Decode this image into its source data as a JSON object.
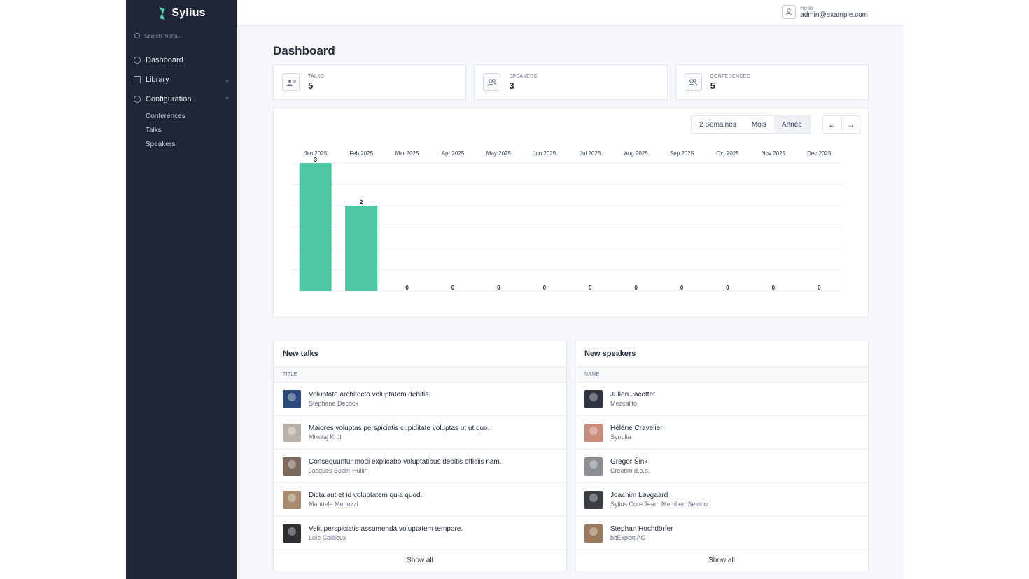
{
  "brand": {
    "name": "Sylius",
    "accent": "#4fc7a4"
  },
  "sidebar": {
    "search_placeholder": "Search menu...",
    "items": [
      {
        "label": "Dashboard",
        "icon": "dashboard-icon"
      },
      {
        "label": "Library",
        "icon": "book-icon",
        "chevron": "⌄"
      },
      {
        "label": "Configuration",
        "icon": "gear-icon",
        "chevron": "⌃"
      }
    ],
    "sub_items": [
      "Conferences",
      "Talks",
      "Speakers"
    ]
  },
  "topbar": {
    "hello": "Hello",
    "email": "admin@example.com"
  },
  "page": {
    "title": "Dashboard"
  },
  "stats": [
    {
      "label": "TALKS",
      "value": "5",
      "icon": "talk-icon"
    },
    {
      "label": "SPEAKERS",
      "value": "3",
      "icon": "users-icon"
    },
    {
      "label": "CONFERENCES",
      "value": "5",
      "icon": "users-icon"
    }
  ],
  "period": {
    "options": [
      "2 Semaines",
      "Mois",
      "Année"
    ],
    "selected": "Année",
    "prev": "←",
    "next": "→"
  },
  "chart_data": {
    "type": "bar",
    "categories": [
      "Jan 2025",
      "Feb 2025",
      "Mar 2025",
      "Apr 2025",
      "May 2025",
      "Jun 2025",
      "Jul 2025",
      "Aug 2025",
      "Sep 2025",
      "Oct 2025",
      "Nov 2025",
      "Dec 2025"
    ],
    "values": [
      3,
      2,
      0,
      0,
      0,
      0,
      0,
      0,
      0,
      0,
      0,
      0
    ],
    "ylim": [
      0,
      3
    ],
    "grid": true,
    "color": "#4fc7a4"
  },
  "new_talks": {
    "title": "New talks",
    "column": "TITLE",
    "rows": [
      {
        "title": "Voluptate architecto voluptatem debitis.",
        "sub": "Stéphane Decock",
        "avatar": "#2b4a7a"
      },
      {
        "title": "Maiores voluptas perspiciatis cupiditate voluptas ut ut quo.",
        "sub": "Mikołaj Król",
        "avatar": "#b9b2aa"
      },
      {
        "title": "Consequuntur modi explicabo voluptatibus debitis officiis nam.",
        "sub": "Jacques Bodin-Hullin",
        "avatar": "#7c6a5d"
      },
      {
        "title": "Dicta aut et id voluptatem quia quod.",
        "sub": "Manuele Menozzi",
        "avatar": "#a88a6e"
      },
      {
        "title": "Velit perspiciatis assumenda voluptatem tempore.",
        "sub": "Loïc Caillieux",
        "avatar": "#2f2f33"
      }
    ],
    "show_all": "Show all"
  },
  "new_speakers": {
    "title": "New speakers",
    "column": "NAME",
    "rows": [
      {
        "title": "Julien Jacottet",
        "sub": "Mezcalito",
        "avatar": "#2e3440"
      },
      {
        "title": "Hélène Cravelier",
        "sub": "Synolia",
        "avatar": "#c98b7a"
      },
      {
        "title": "Gregor Šink",
        "sub": "Creatim d.o.o.",
        "avatar": "#8b8f94"
      },
      {
        "title": "Joachim Løvgaard",
        "sub": "Sylius Core Team Member, Setono",
        "avatar": "#3a3d42"
      },
      {
        "title": "Stephan Hochdörfer",
        "sub": "bitExpert AG",
        "avatar": "#9c7a5e"
      }
    ],
    "show_all": "Show all"
  }
}
